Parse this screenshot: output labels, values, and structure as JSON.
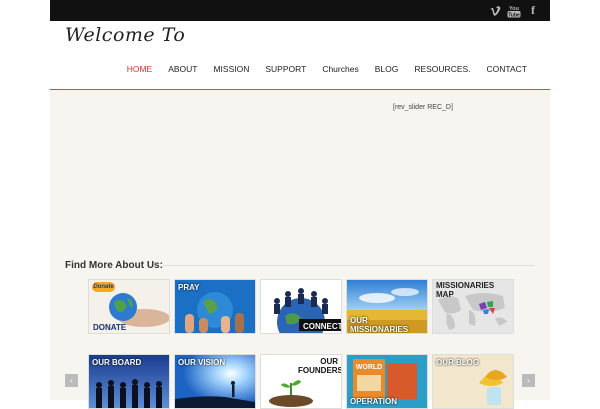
{
  "header": {
    "logo_text": "Welcome To"
  },
  "social": {
    "icons": [
      "vimeo-icon",
      "youtube-icon",
      "facebook-icon"
    ],
    "youtube_text": "You Tube"
  },
  "nav": {
    "items": [
      {
        "label": "HOME",
        "active": true
      },
      {
        "label": "ABOUT"
      },
      {
        "label": "MISSION"
      },
      {
        "label": "SUPPORT"
      },
      {
        "label": "Churches"
      },
      {
        "label": "BLOG"
      },
      {
        "label": "RESOURCES."
      },
      {
        "label": "CONTACT"
      }
    ]
  },
  "slider": {
    "placeholder": "[rev_slider REC_D]"
  },
  "find_more": {
    "title": "Find More About Us:"
  },
  "tiles": {
    "row1": [
      {
        "label": "DONATE",
        "badge": "Donate"
      },
      {
        "label": "PRAY"
      },
      {
        "label": "CONNECT"
      },
      {
        "label": "OUR MISSIONARIES"
      },
      {
        "label": "MISSIONARIES MAP"
      }
    ],
    "row2": [
      {
        "label": "OUR BOARD"
      },
      {
        "label": "OUR VISION"
      },
      {
        "label": "OUR FOUNDERS"
      },
      {
        "label": "OPERATION",
        "book_title": "WORLD"
      },
      {
        "label": "OUR BLOG"
      }
    ]
  },
  "arrows": {
    "prev": "‹",
    "next": "›"
  },
  "colors": {
    "accent": "#d43030",
    "topbar": "#111111",
    "background": "#f6f5ef"
  }
}
